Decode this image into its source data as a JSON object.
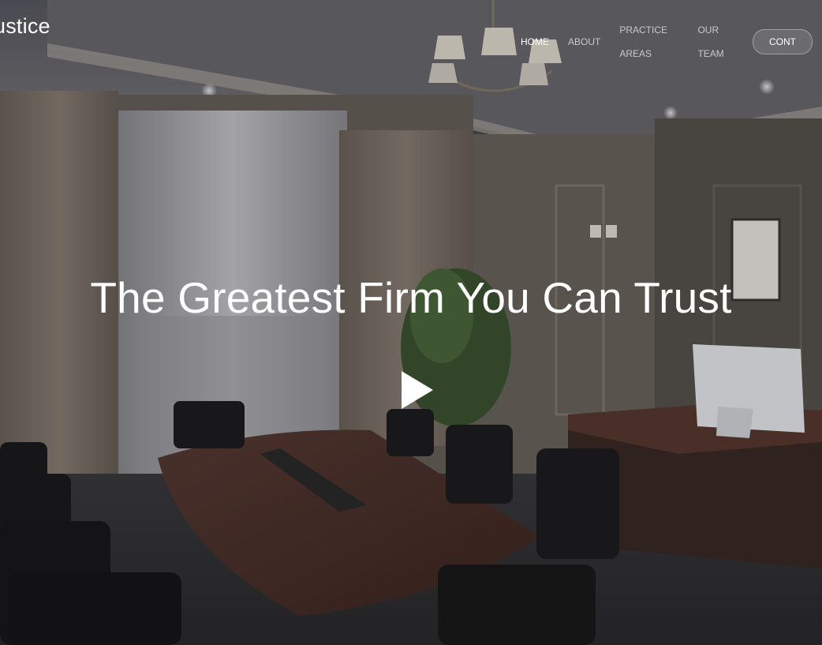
{
  "brand": {
    "text": "ustice"
  },
  "nav": {
    "items": [
      {
        "label": "HOME",
        "active": true
      },
      {
        "label": "ABOUT"
      },
      {
        "label": "PRACTICE AREAS"
      },
      {
        "label": "OUR TEAM"
      }
    ],
    "cta_label": "CONT"
  },
  "hero": {
    "headline": "The Greatest Firm You Can Trust",
    "play_icon": "play-icon"
  },
  "colors": {
    "overlay": "#000000",
    "text": "#ffffff",
    "nav_text": "#c9c9c9"
  }
}
